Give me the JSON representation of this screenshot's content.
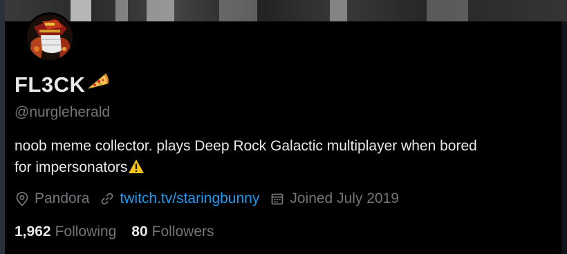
{
  "profile": {
    "display_name": "FL3CK",
    "display_name_emoji": "pizza-icon",
    "handle": "@nurgleherald",
    "bio_line_1": "noob meme collector. plays Deep Rock Galactic multiplayer when bored",
    "bio_line_2": "for impersonators",
    "bio_emoji": "warning-icon"
  },
  "meta": {
    "location": "Pandora",
    "website": "twitch.tv/staringbunny",
    "joined": "Joined July 2019"
  },
  "stats": {
    "following_count": "1,962",
    "following_label": "Following",
    "followers_count": "80",
    "followers_label": "Followers"
  },
  "colors": {
    "background": "#000000",
    "primary_text": "#e7e9ea",
    "secondary_text": "#71767b",
    "link": "#1d9bf0",
    "warning": "#f4c21b"
  }
}
